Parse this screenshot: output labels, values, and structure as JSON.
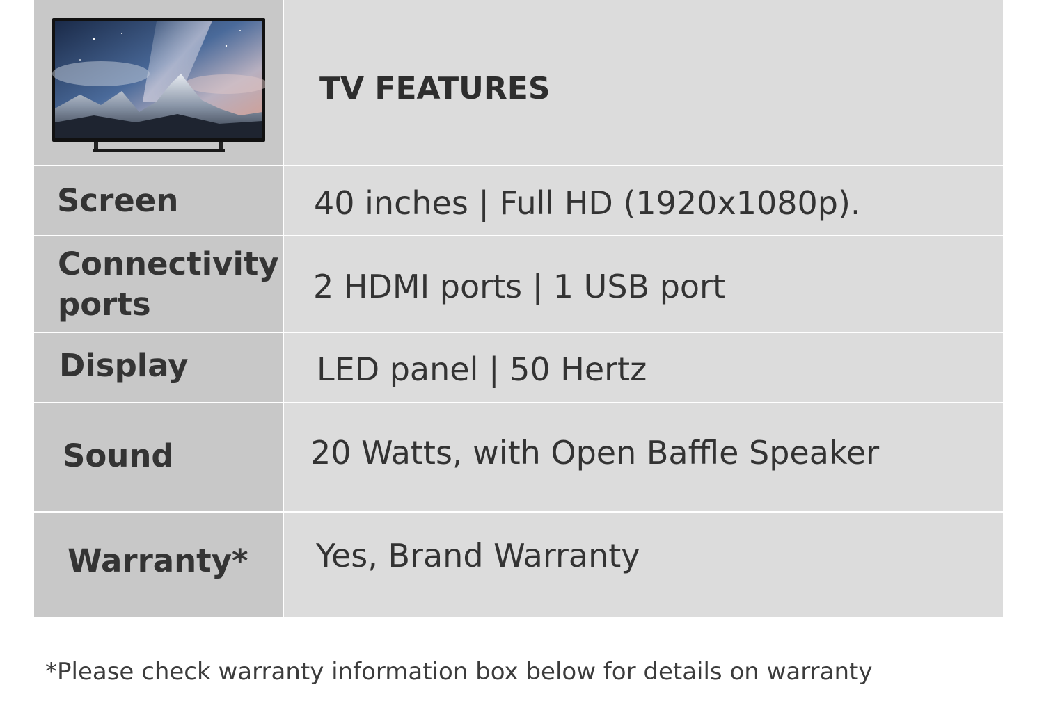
{
  "header": {
    "title": "TV FEATURES",
    "image": "tv-product-image"
  },
  "rows": [
    {
      "label": "Screen",
      "value": "40 inches | Full HD (1920x1080p)."
    },
    {
      "label_line1": "Connectivity",
      "label_line2": "ports",
      "value": "2 HDMI ports | 1 USB port"
    },
    {
      "label": "Display",
      "value": "LED panel | 50 Hertz"
    },
    {
      "label": "Sound",
      "value": "20 Watts, with Open Baffle Speaker"
    },
    {
      "label": "Warranty*",
      "value": "Yes, Brand Warranty"
    }
  ],
  "footnote": "*Please check warranty information box below for details on warranty",
  "colors": {
    "label_bg": "#c8c8c8",
    "value_bg": "#dcdcdc",
    "text": "#333333"
  }
}
